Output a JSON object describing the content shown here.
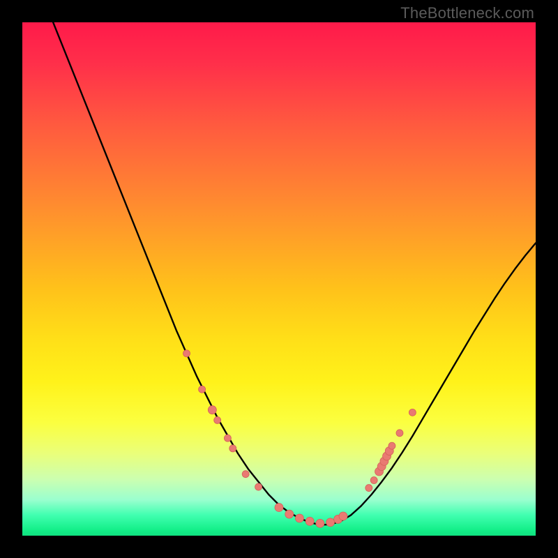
{
  "watermark": "TheBottleneck.com",
  "colors": {
    "curve": "#000000",
    "marker_fill": "#e97a72",
    "marker_stroke": "#d46058"
  },
  "chart_data": {
    "type": "line",
    "title": "",
    "xlabel": "",
    "ylabel": "",
    "xlim": [
      0,
      100
    ],
    "ylim": [
      0,
      100
    ],
    "grid": false,
    "legend": false,
    "series": [
      {
        "name": "bottleneck-curve",
        "x": [
          6,
          8,
          10,
          12,
          14,
          16,
          18,
          20,
          22,
          24,
          26,
          28,
          30,
          32,
          34,
          36,
          38,
          40,
          42,
          44,
          46,
          48,
          50,
          52,
          54,
          56,
          58,
          60,
          62,
          64,
          66,
          68,
          70,
          72,
          74,
          76,
          78,
          80,
          82,
          84,
          86,
          88,
          90,
          92,
          94,
          96,
          98,
          100
        ],
        "y": [
          100,
          95,
          90,
          85,
          80,
          75,
          70,
          65,
          60,
          55,
          50,
          45,
          40,
          35.5,
          31,
          27,
          23,
          19.5,
          16,
          13,
          10.5,
          8,
          6,
          4.5,
          3.4,
          2.6,
          2.1,
          2.2,
          2.8,
          4,
          5.8,
          8,
          10.5,
          13.2,
          16.2,
          19.4,
          22.8,
          26.2,
          29.6,
          33,
          36.4,
          39.8,
          43,
          46.2,
          49.2,
          52,
          54.6,
          57
        ]
      }
    ],
    "markers": [
      {
        "x": 32,
        "y": 35.5,
        "r": 5
      },
      {
        "x": 35,
        "y": 28.5,
        "r": 5
      },
      {
        "x": 37,
        "y": 24.5,
        "r": 6
      },
      {
        "x": 38,
        "y": 22.5,
        "r": 5
      },
      {
        "x": 40,
        "y": 19,
        "r": 5
      },
      {
        "x": 41,
        "y": 17,
        "r": 5
      },
      {
        "x": 43.5,
        "y": 12,
        "r": 5
      },
      {
        "x": 46,
        "y": 9.5,
        "r": 5
      },
      {
        "x": 50,
        "y": 5.5,
        "r": 6
      },
      {
        "x": 52,
        "y": 4.2,
        "r": 6
      },
      {
        "x": 54,
        "y": 3.4,
        "r": 6
      },
      {
        "x": 56,
        "y": 2.8,
        "r": 6
      },
      {
        "x": 58,
        "y": 2.4,
        "r": 6
      },
      {
        "x": 60,
        "y": 2.6,
        "r": 6
      },
      {
        "x": 61.5,
        "y": 3.2,
        "r": 6
      },
      {
        "x": 62.5,
        "y": 3.8,
        "r": 6
      },
      {
        "x": 67.5,
        "y": 9.3,
        "r": 5
      },
      {
        "x": 68.5,
        "y": 10.8,
        "r": 5
      },
      {
        "x": 69.5,
        "y": 12.5,
        "r": 6
      },
      {
        "x": 70,
        "y": 13.5,
        "r": 6
      },
      {
        "x": 70.5,
        "y": 14.5,
        "r": 6
      },
      {
        "x": 71,
        "y": 15.5,
        "r": 6
      },
      {
        "x": 71.5,
        "y": 16.5,
        "r": 6
      },
      {
        "x": 72,
        "y": 17.5,
        "r": 5
      },
      {
        "x": 73.5,
        "y": 20,
        "r": 5
      },
      {
        "x": 76,
        "y": 24,
        "r": 5
      }
    ]
  }
}
